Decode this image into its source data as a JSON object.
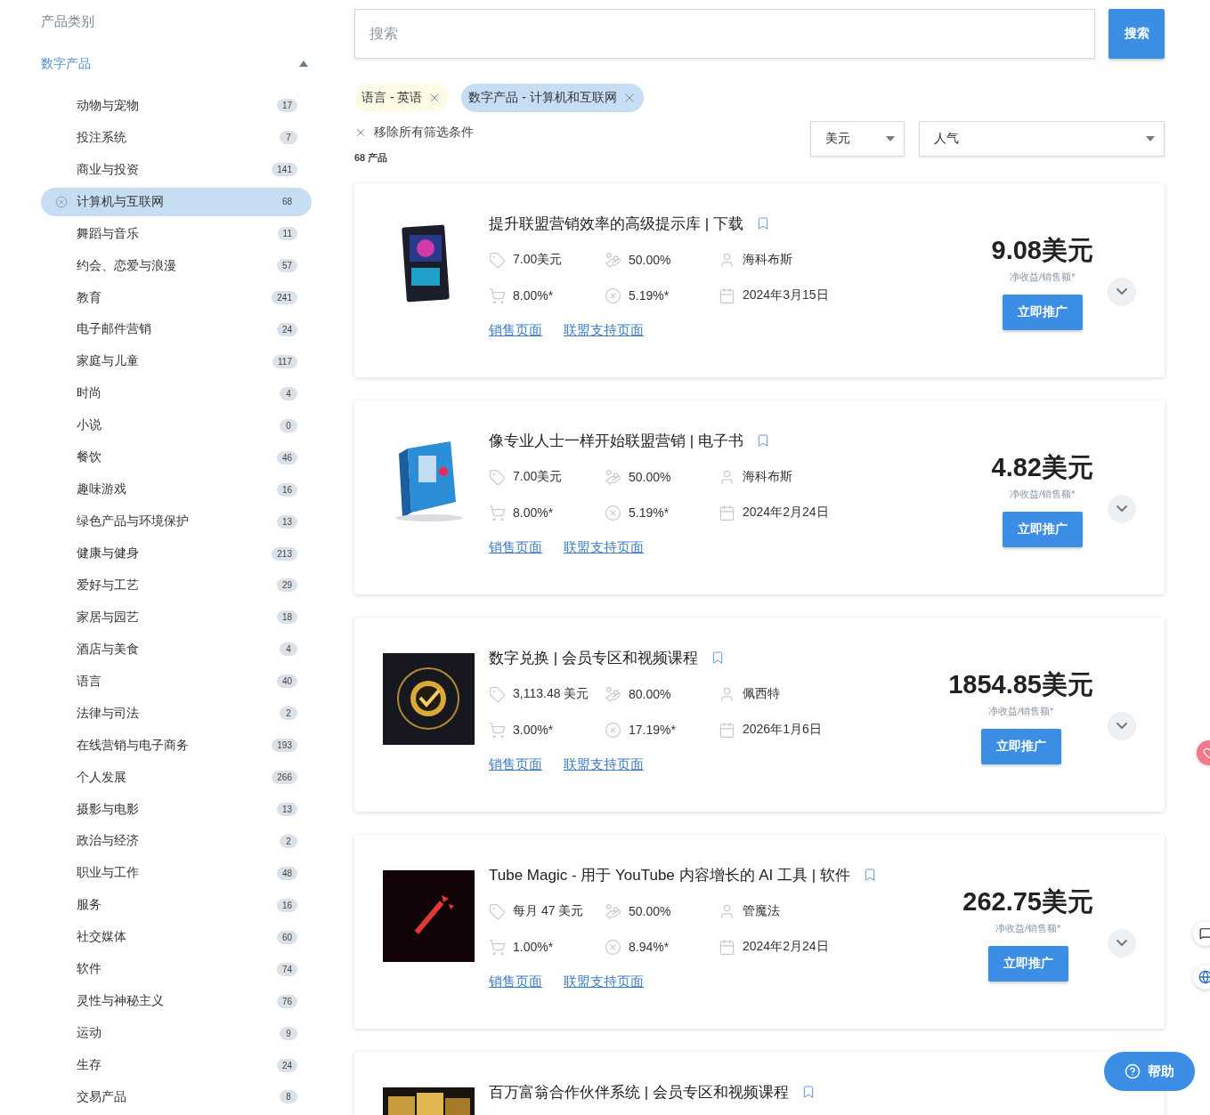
{
  "sidebar": {
    "title": "产品类别",
    "group": {
      "label": "数字产品",
      "expanded": true,
      "items": [
        {
          "label": "动物与宠物",
          "count": "17",
          "selected": false
        },
        {
          "label": "投注系统",
          "count": "7",
          "selected": false
        },
        {
          "label": "商业与投资",
          "count": "141",
          "selected": false
        },
        {
          "label": "计算机与互联网",
          "count": "68",
          "selected": true
        },
        {
          "label": "舞蹈与音乐",
          "count": "11",
          "selected": false
        },
        {
          "label": "约会、恋爱与浪漫",
          "count": "57",
          "selected": false
        },
        {
          "label": "教育",
          "count": "241",
          "selected": false
        },
        {
          "label": "电子邮件营销",
          "count": "24",
          "selected": false
        },
        {
          "label": "家庭与儿童",
          "count": "117",
          "selected": false
        },
        {
          "label": "时尚",
          "count": "4",
          "selected": false
        },
        {
          "label": "小说",
          "count": "0",
          "selected": false
        },
        {
          "label": "餐饮",
          "count": "46",
          "selected": false
        },
        {
          "label": "趣味游戏",
          "count": "16",
          "selected": false
        },
        {
          "label": "绿色产品与环境保护",
          "count": "13",
          "selected": false
        },
        {
          "label": "健康与健身",
          "count": "213",
          "selected": false
        },
        {
          "label": "爱好与工艺",
          "count": "29",
          "selected": false
        },
        {
          "label": "家居与园艺",
          "count": "18",
          "selected": false
        },
        {
          "label": "酒店与美食",
          "count": "4",
          "selected": false
        },
        {
          "label": "语言",
          "count": "40",
          "selected": false
        },
        {
          "label": "法律与司法",
          "count": "2",
          "selected": false
        },
        {
          "label": "在线营销与电子商务",
          "count": "193",
          "selected": false
        },
        {
          "label": "个人发展",
          "count": "266",
          "selected": false
        },
        {
          "label": "摄影与电影",
          "count": "13",
          "selected": false
        },
        {
          "label": "政治与经济",
          "count": "2",
          "selected": false
        },
        {
          "label": "职业与工作",
          "count": "48",
          "selected": false
        },
        {
          "label": "服务",
          "count": "16",
          "selected": false
        },
        {
          "label": "社交媒体",
          "count": "60",
          "selected": false
        },
        {
          "label": "软件",
          "count": "74",
          "selected": false
        },
        {
          "label": "灵性与神秘主义",
          "count": "76",
          "selected": false
        },
        {
          "label": "运动",
          "count": "9",
          "selected": false
        },
        {
          "label": "生存",
          "count": "24",
          "selected": false
        },
        {
          "label": "交易产品",
          "count": "8",
          "selected": false
        }
      ]
    }
  },
  "search": {
    "placeholder": "搜索",
    "button": "搜索"
  },
  "filters": [
    {
      "label": "语言 - 英语",
      "color": "#fffbe6"
    },
    {
      "label": "数字产品 - 计算机和互联网",
      "color": "#c6ddf3"
    }
  ],
  "clear_filters": "移除所有筛选条件",
  "result_count": "68 产品",
  "currency": "美元",
  "sort": "人气",
  "products": [
    {
      "title": "提升联盟营销效率的高级提示库 | 下载",
      "stats": [
        {
          "kind": "price",
          "text": "7.00美元"
        },
        {
          "kind": "commission",
          "text": "50.00%"
        },
        {
          "kind": "vendor",
          "text": "海科布斯"
        },
        {
          "kind": "conversion",
          "text": "8.00%*"
        },
        {
          "kind": "refund",
          "text": "5.19%*"
        },
        {
          "kind": "date",
          "text": "2024年3月15日"
        }
      ],
      "links": [
        "销售页面",
        "联盟支持页面"
      ],
      "earnings": "9.08美元",
      "earnings_label": "净收益/销售额*",
      "button": "立即推广"
    },
    {
      "title": "像专业人士一样开始联盟营销 | 电子书",
      "stats": [
        {
          "kind": "price",
          "text": "7.00美元"
        },
        {
          "kind": "commission",
          "text": "50.00%"
        },
        {
          "kind": "vendor",
          "text": "海科布斯"
        },
        {
          "kind": "conversion",
          "text": "8.00%*"
        },
        {
          "kind": "refund",
          "text": "5.19%*"
        },
        {
          "kind": "date",
          "text": "2024年2月24日"
        }
      ],
      "links": [
        "销售页面",
        "联盟支持页面"
      ],
      "earnings": "4.82美元",
      "earnings_label": "净收益/销售额*",
      "button": "立即推广"
    },
    {
      "title": "数字兑换 | 会员专区和视频课程",
      "stats": [
        {
          "kind": "price",
          "text": "3,113.48 美元"
        },
        {
          "kind": "commission",
          "text": "80.00%"
        },
        {
          "kind": "vendor",
          "text": "佩西特"
        },
        {
          "kind": "conversion",
          "text": "3.00%*"
        },
        {
          "kind": "refund",
          "text": "17.19%*"
        },
        {
          "kind": "date",
          "text": "2026年1月6日"
        }
      ],
      "links": [
        "销售页面",
        "联盟支持页面"
      ],
      "earnings": "1854.85美元",
      "earnings_label": "净收益/销售额*",
      "button": "立即推广"
    },
    {
      "title": "Tube Magic - 用于 YouTube 内容增长的 AI 工具 | 软件",
      "stats": [
        {
          "kind": "price",
          "text": "每月 47 美元"
        },
        {
          "kind": "commission",
          "text": "50.00%"
        },
        {
          "kind": "vendor",
          "text": "管魔法"
        },
        {
          "kind": "conversion",
          "text": "1.00%*"
        },
        {
          "kind": "refund",
          "text": "8.94%*"
        },
        {
          "kind": "date",
          "text": "2024年2月24日"
        }
      ],
      "links": [
        "销售页面",
        "联盟支持页面"
      ],
      "earnings": "262.75美元",
      "earnings_label": "净收益/销售额*",
      "button": "立即推广"
    },
    {
      "title": "百万富翁合作伙伴系统 | 会员专区和视频课程"
    }
  ],
  "help_button": "帮助"
}
